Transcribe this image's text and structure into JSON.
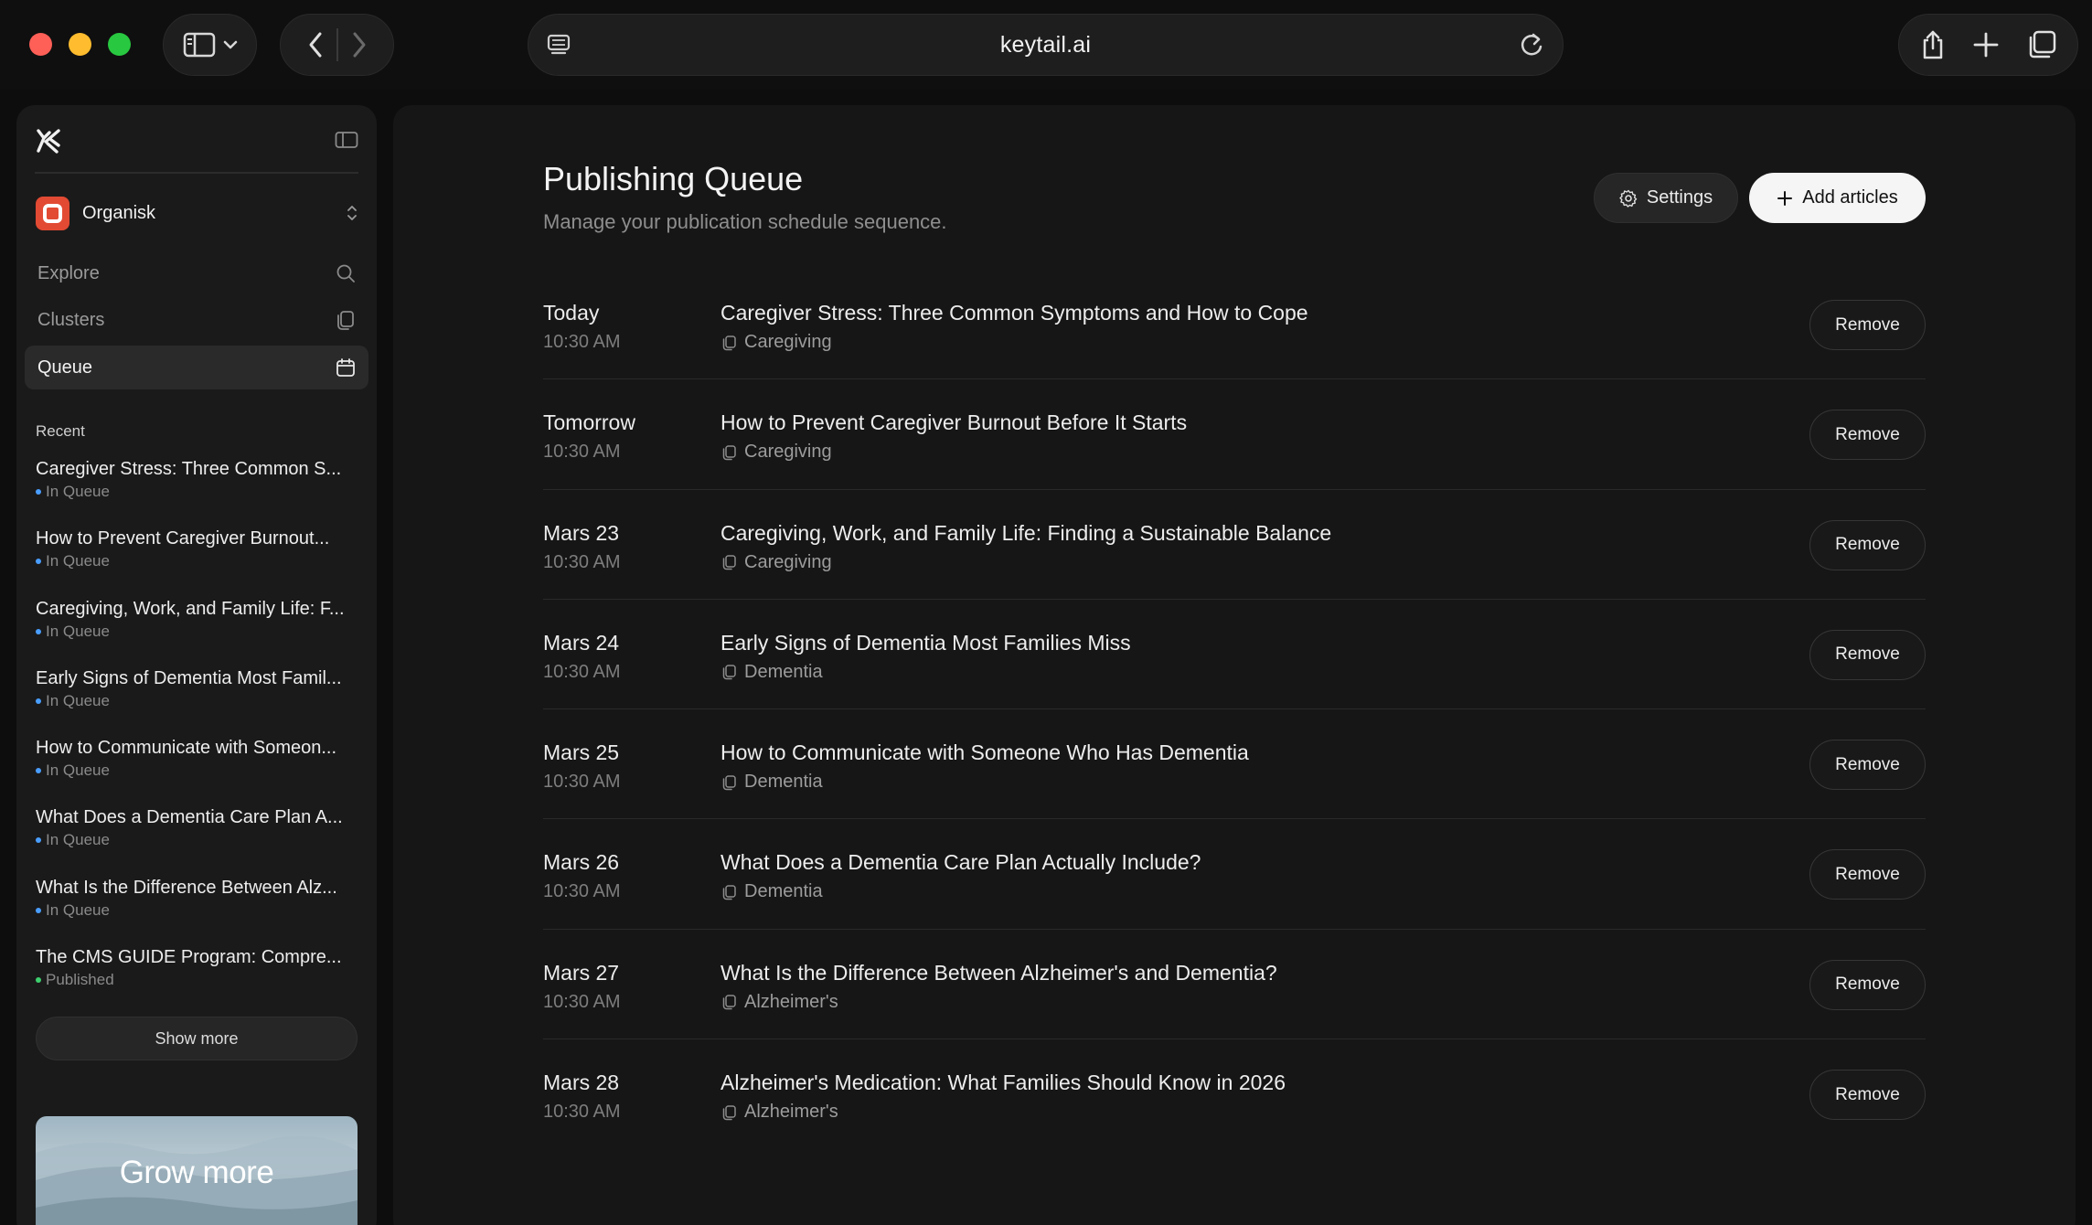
{
  "browser": {
    "url": "keytail.ai"
  },
  "sidebar": {
    "org_name": "Organisk",
    "nav": [
      {
        "label": "Explore",
        "icon": "search-icon"
      },
      {
        "label": "Clusters",
        "icon": "clusters-icon"
      },
      {
        "label": "Queue",
        "icon": "calendar-icon"
      }
    ],
    "recent_title": "Recent",
    "recent": [
      {
        "title": "Caregiver Stress: Three Common S...",
        "status": "In Queue",
        "status_color": "#4a9eff"
      },
      {
        "title": "How to Prevent Caregiver Burnout...",
        "status": "In Queue",
        "status_color": "#4a9eff"
      },
      {
        "title": "Caregiving, Work, and Family Life: F...",
        "status": "In Queue",
        "status_color": "#4a9eff"
      },
      {
        "title": "Early Signs of Dementia Most Famil...",
        "status": "In Queue",
        "status_color": "#4a9eff"
      },
      {
        "title": "How to Communicate with Someon...",
        "status": "In Queue",
        "status_color": "#4a9eff"
      },
      {
        "title": "What Does a Dementia Care Plan A...",
        "status": "In Queue",
        "status_color": "#4a9eff"
      },
      {
        "title": "What Is the Difference Between Alz...",
        "status": "In Queue",
        "status_color": "#4a9eff"
      },
      {
        "title": "The CMS GUIDE Program: Compre...",
        "status": "Published",
        "status_color": "#3ecf6e"
      }
    ],
    "show_more": "Show more",
    "promo_text": "Grow more"
  },
  "main": {
    "title": "Publishing Queue",
    "subtitle": "Manage your publication schedule sequence.",
    "settings_label": "Settings",
    "add_label": "Add articles",
    "remove_label": "Remove",
    "queue": [
      {
        "date": "Today",
        "time": "10:30 AM",
        "title": "Caregiver Stress: Three Common Symptoms and How to Cope",
        "tag": "Caregiving"
      },
      {
        "date": "Tomorrow",
        "time": "10:30 AM",
        "title": "How to Prevent Caregiver Burnout Before It Starts",
        "tag": "Caregiving"
      },
      {
        "date": "Mars 23",
        "time": "10:30 AM",
        "title": "Caregiving, Work, and Family Life: Finding a Sustainable Balance",
        "tag": "Caregiving"
      },
      {
        "date": "Mars 24",
        "time": "10:30 AM",
        "title": "Early Signs of Dementia Most Families Miss",
        "tag": "Dementia"
      },
      {
        "date": "Mars 25",
        "time": "10:30 AM",
        "title": "How to Communicate with Someone Who Has Dementia",
        "tag": "Dementia"
      },
      {
        "date": "Mars 26",
        "time": "10:30 AM",
        "title": "What Does a Dementia Care Plan Actually Include?",
        "tag": "Dementia"
      },
      {
        "date": "Mars 27",
        "time": "10:30 AM",
        "title": "What Is the Difference Between Alzheimer's and Dementia?",
        "tag": "Alzheimer's"
      },
      {
        "date": "Mars 28",
        "time": "10:30 AM",
        "title": "Alzheimer's Medication: What Families Should Know in 2026",
        "tag": "Alzheimer's"
      }
    ]
  }
}
